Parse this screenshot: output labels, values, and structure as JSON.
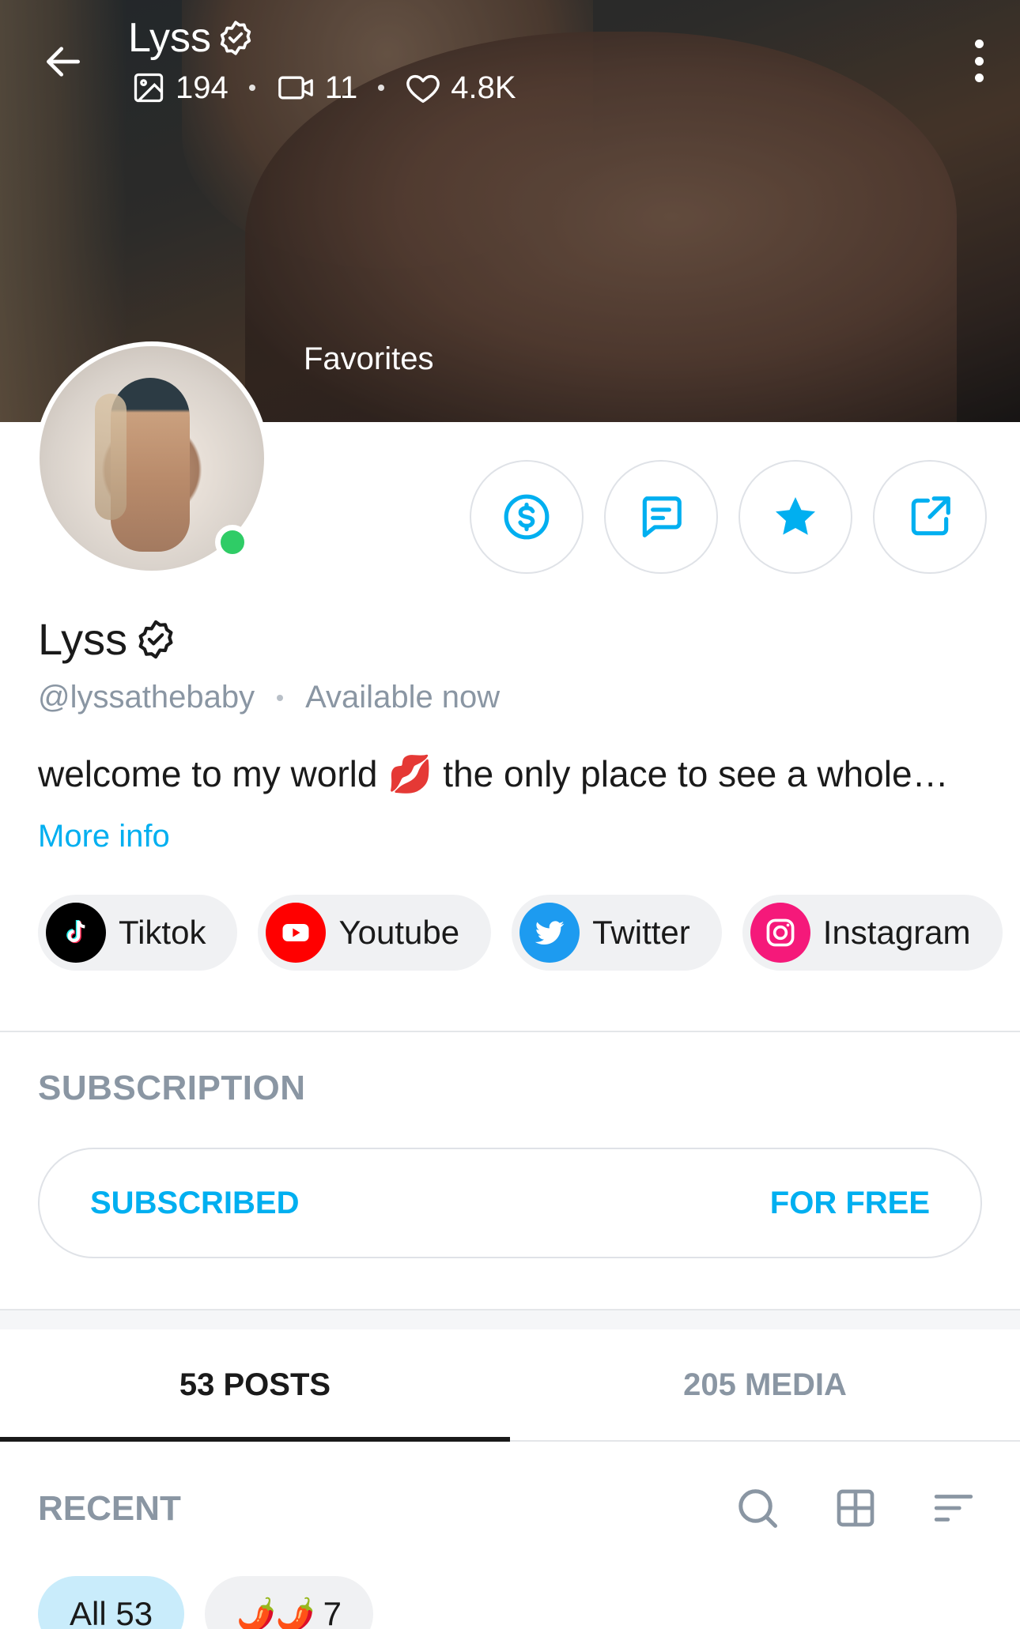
{
  "header": {
    "title": "Lyss",
    "stats": {
      "photos": "194",
      "videos": "11",
      "likes": "4.8K"
    },
    "cover_label": "Favorites"
  },
  "profile": {
    "name": "Lyss",
    "handle": "@lyssathebaby",
    "status": "Available now",
    "bio": "welcome to my world 💋 the only place to see a whole…",
    "more_info": "More info"
  },
  "socials": [
    {
      "label": "Tiktok",
      "icon": "tiktok-icon",
      "color": "#000000"
    },
    {
      "label": "Youtube",
      "icon": "youtube-icon",
      "color": "#ff0000"
    },
    {
      "label": "Twitter",
      "icon": "twitter-icon",
      "color": "#1d9bf0"
    },
    {
      "label": "Instagram",
      "icon": "instagram-icon",
      "color": "#e1306c"
    }
  ],
  "subscription": {
    "title": "SUBSCRIPTION",
    "status": "SUBSCRIBED",
    "price": "FOR FREE"
  },
  "tabs": [
    {
      "label": "53 POSTS",
      "active": true
    },
    {
      "label": "205 MEDIA",
      "active": false
    }
  ],
  "recent": {
    "label": "RECENT",
    "filters": [
      {
        "label": "All 53",
        "active": true
      },
      {
        "label": "🌶️🌶️",
        "count": "7",
        "active": false
      }
    ]
  },
  "colors": {
    "accent": "#00aff0",
    "muted": "#8a96a3",
    "online": "#2fcc66"
  }
}
